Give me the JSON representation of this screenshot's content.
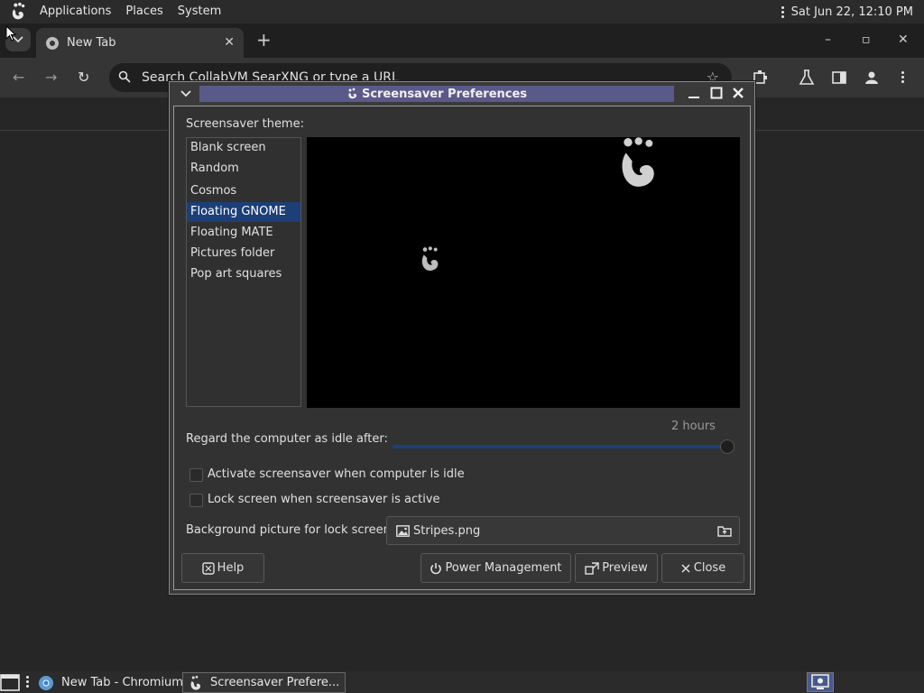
{
  "top_panel": {
    "menus": [
      "Applications",
      "Places",
      "System"
    ],
    "clock": "Sat Jun 22, 12:10 PM"
  },
  "browser": {
    "tab_title": "New Tab",
    "omnibox_placeholder": "Search CollabVM SearXNG or type a URL",
    "window_controls": [
      "–",
      "▫",
      "✕"
    ]
  },
  "dialog": {
    "title": "Screensaver Preferences",
    "theme_label": "Screensaver theme:",
    "themes": [
      "Blank screen",
      "Random",
      "Cosmos",
      "Floating GNOME",
      "Floating MATE",
      "Pictures folder",
      "Pop art squares"
    ],
    "selected_theme": "Floating GNOME",
    "idle_label": "Regard the computer as idle after:",
    "idle_value": "2 hours",
    "idle_fraction": 1.0,
    "activate_label": "Activate screensaver when computer is idle",
    "activate_checked": false,
    "lock_label": "Lock screen when screensaver is active",
    "lock_checked": false,
    "background_label": "Background picture for lock screen:",
    "background_file": "Stripes.png",
    "buttons": {
      "help": "Help",
      "power": "Power Management",
      "preview": "Preview",
      "close": "Close"
    }
  },
  "taskbar": {
    "tasks": [
      "New Tab - Chromium",
      "Screensaver Prefere..."
    ]
  },
  "colors": {
    "selection": "#1c3f78",
    "title_stripe": "#5a5a8a"
  }
}
